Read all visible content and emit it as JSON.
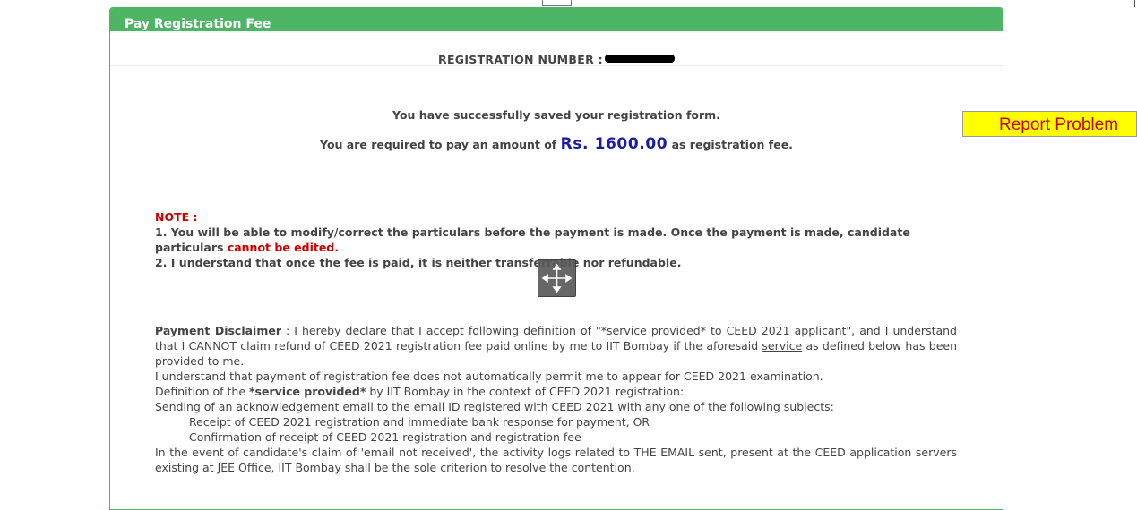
{
  "panel": {
    "title": "Pay Registration Fee"
  },
  "registration": {
    "label": "REGISTRATION NUMBER :"
  },
  "messages": {
    "saved": "You have successfully saved your registration form.",
    "pay_prefix": "You are required to pay an amount of",
    "amount": "Rs. 1600.00",
    "pay_suffix": "as registration fee."
  },
  "note": {
    "title": "NOTE :",
    "line1_a": "1. You will be able to modify/correct the particulars before the payment is made. Once the payment is made, candidate particulars",
    "line1_b": "cannot be edited",
    "line1_c": ".",
    "line2": "2. I understand that once the fee is paid, it is neither transferrable nor refundable."
  },
  "disclaimer": {
    "heading": "Payment Disclaimer",
    "p1_a": " : I hereby declare that I accept following definition of \"*service provided* to CEED 2021 applicant\", and I understand that I CANNOT claim refund of CEED 2021 registration fee paid online by me to IIT Bombay if the aforesaid ",
    "p1_link": "service",
    "p1_b": " as defined below has been provided to me.",
    "p2": "I understand that payment of registration fee does not automatically permit me to appear for CEED 2021 examination.",
    "p3_a": "Definition of the ",
    "p3_bold": "*service provided*",
    "p3_b": " by IIT Bombay in the context of CEED 2021 registration:",
    "p4": "Sending of an acknowledgement email to the email ID registered with CEED 2021 with any one of the following subjects:",
    "sub1": "Receipt of CEED 2021 registration and immediate bank response for payment, OR",
    "sub2": "Confirmation of receipt of CEED 2021 registration and registration fee",
    "p5": "In the event of candidate's claim of 'email not received', the activity logs related to THE EMAIL sent, present at the CEED application servers existing at JEE Office, IIT Bombay shall be the sole criterion to resolve the contention."
  },
  "report": {
    "label": "Report Problem"
  },
  "icons": {
    "move": "move-arrows-icon"
  },
  "colors": {
    "header_green": "#4cb566",
    "amount_blue": "#1a1aa6",
    "note_red": "#cc0000",
    "report_bg": "#ffff00",
    "report_text": "#cc0000"
  }
}
